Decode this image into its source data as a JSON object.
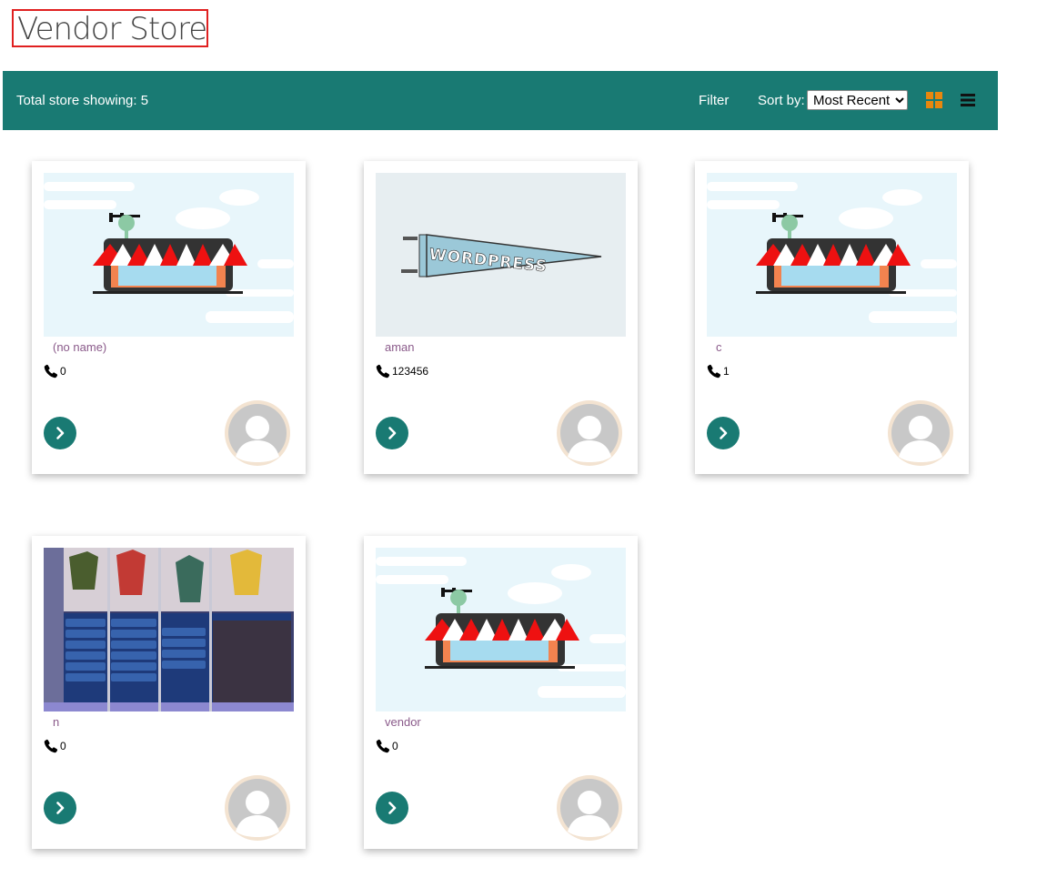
{
  "page": {
    "title": "Vendor Store"
  },
  "toolbar": {
    "count_text": "Total store showing: 5",
    "filter_label": "Filter",
    "sort_label": "Sort by:",
    "sort_selected": "Most Recent",
    "accent_color": "#197a73",
    "grid_icon_color": "#e8870e"
  },
  "stores": [
    {
      "name": "(no name)",
      "phone": "0",
      "banner": "store-illustration"
    },
    {
      "name": "aman",
      "phone": "123456",
      "banner": "wordpress-pennant"
    },
    {
      "name": "c",
      "phone": "1",
      "banner": "store-illustration"
    },
    {
      "name": "n",
      "phone": "0",
      "banner": "clothing-store-photo"
    },
    {
      "name": "vendor",
      "phone": "0",
      "banner": "store-illustration"
    }
  ],
  "pennant_text": "WORDPRESS"
}
